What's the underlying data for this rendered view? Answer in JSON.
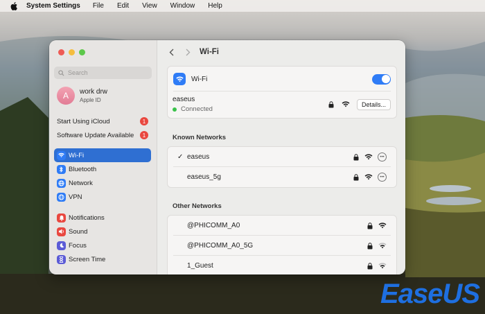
{
  "menubar": {
    "app": "System Settings",
    "items": [
      "File",
      "Edit",
      "View",
      "Window",
      "Help"
    ]
  },
  "sidebar": {
    "search_placeholder": "Search",
    "account": {
      "initial": "A",
      "name": "work drw",
      "subtitle": "Apple ID"
    },
    "alerts": [
      {
        "label": "Start Using iCloud",
        "badge": "1"
      },
      {
        "label": "Software Update Available",
        "badge": "1"
      }
    ],
    "items": [
      {
        "label": "Wi-Fi",
        "icon": "wifi-icon",
        "color": "#2f7cf6",
        "selected": true
      },
      {
        "label": "Bluetooth",
        "icon": "bluetooth-icon",
        "color": "#2f7cf6"
      },
      {
        "label": "Network",
        "icon": "globe-icon",
        "color": "#2f7cf6"
      },
      {
        "label": "VPN",
        "icon": "vpn-globe-icon",
        "color": "#2f7cf6"
      },
      {
        "label": "Notifications",
        "icon": "bell-icon",
        "color": "#e9473f"
      },
      {
        "label": "Sound",
        "icon": "speaker-icon",
        "color": "#e9473f"
      },
      {
        "label": "Focus",
        "icon": "moon-icon",
        "color": "#5b5bd6"
      },
      {
        "label": "Screen Time",
        "icon": "hourglass-icon",
        "color": "#5b5bd6"
      }
    ]
  },
  "content": {
    "title": "Wi-Fi",
    "wifi_toggle_label": "Wi-Fi",
    "wifi_on": true,
    "current": {
      "ssid": "easeus",
      "status": "Connected",
      "details_label": "Details..."
    },
    "known_header": "Known Networks",
    "known": [
      {
        "ssid": "easeus",
        "checked": true
      },
      {
        "ssid": "easeus_5g",
        "checked": false
      }
    ],
    "other_header": "Other Networks",
    "other": [
      {
        "ssid": "@PHICOMM_A0"
      },
      {
        "ssid": "@PHICOMM_A0_5G"
      },
      {
        "ssid": "1_Guest"
      }
    ]
  },
  "watermark": {
    "text": "EaseUS",
    "color_main": "#1e6fe0",
    "color_accent": "#f58220"
  },
  "colors": {
    "accent": "#2f7cf6",
    "selected_row": "#2f6fd2",
    "badge": "#e9473f",
    "connected": "#3ac24a"
  }
}
